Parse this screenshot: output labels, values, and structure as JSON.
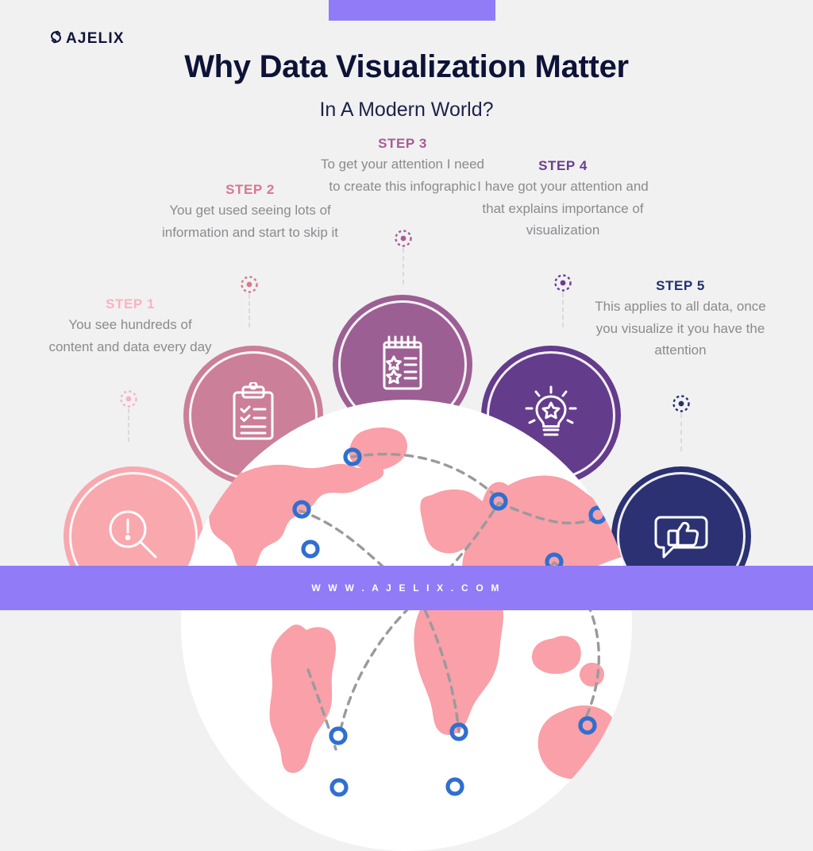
{
  "brand": {
    "logo_text": "AJELIX",
    "logo_icon": "ajelix-s-mark-icon"
  },
  "header": {
    "title": "Why Data Visualization Matter",
    "subtitle": "In A Modern World?",
    "title_color": "#0d1236",
    "accent_bar_color": "#917bf7"
  },
  "steps": [
    {
      "label": "STEP 1",
      "description": "You see hundreds of content and data every day",
      "color": "#f9b3bf",
      "circle_color": "#f9a8ae",
      "icon": "magnifier-exclamation-icon"
    },
    {
      "label": "STEP 2",
      "description": "You get used seeing lots of information and start to skip it",
      "color": "#d4798f",
      "circle_color": "#cb7f99",
      "icon": "clipboard-checklist-icon"
    },
    {
      "label": "STEP 3",
      "description": "To get your attention I need to create this infographic",
      "color": "#a95c94",
      "circle_color": "#9c5f93",
      "icon": "notepad-stars-icon"
    },
    {
      "label": "STEP 4",
      "description": "I have got your attention and that explains importance of visualization",
      "color": "#6b3e8f",
      "circle_color": "#643c8c",
      "icon": "lightbulb-star-icon"
    },
    {
      "label": "STEP 5",
      "description": "This applies to all data, once you visualize it you have the attention",
      "color": "#24306e",
      "circle_color": "#2b3172",
      "icon": "thumbs-up-bubble-icon"
    }
  ],
  "globe": {
    "icon": "world-map-network-icon",
    "land_color": "#f9a0a8",
    "marker_color": "#2f6fd0",
    "route_color": "#9a9a9d",
    "markers": 12
  },
  "footer": {
    "url": "W W W . A J E L I X . C O M",
    "background": "#917bf7"
  }
}
